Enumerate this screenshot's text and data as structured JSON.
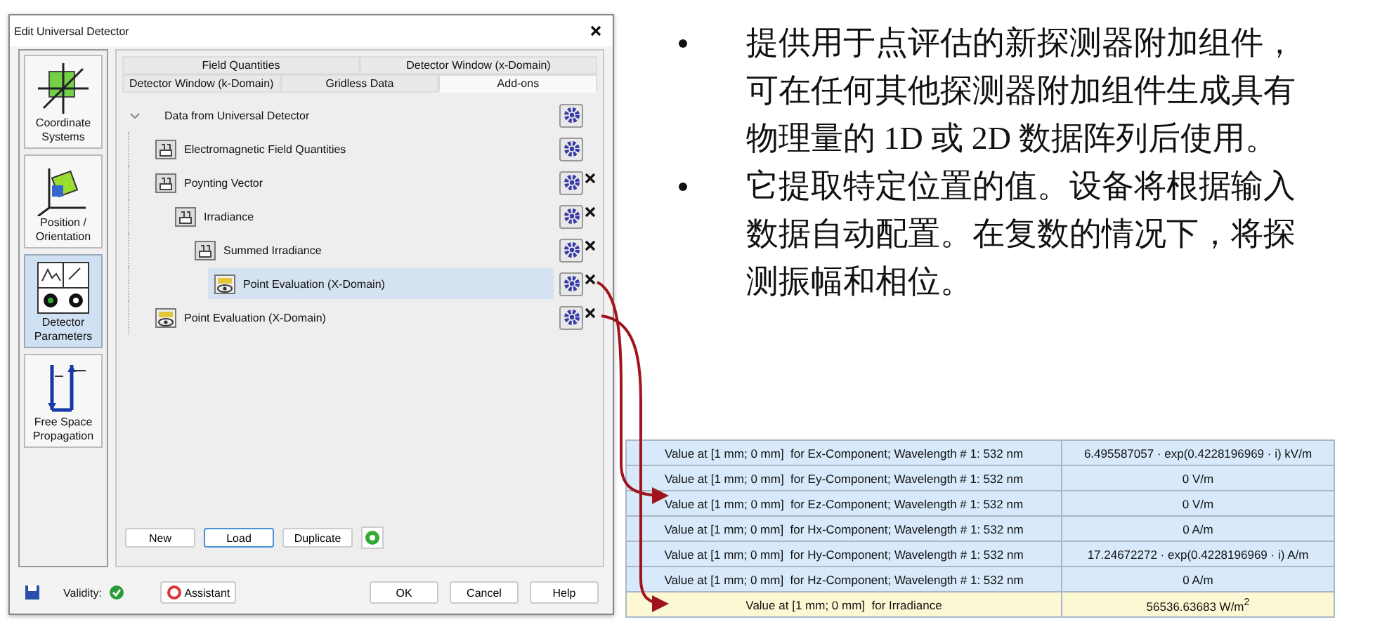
{
  "dialog": {
    "title": "Edit Universal Detector",
    "sidebar": [
      {
        "label": "Coordinate Systems",
        "selected": false
      },
      {
        "label": "Position / Orientation",
        "selected": false
      },
      {
        "label": "Detector Parameters",
        "selected": true
      },
      {
        "label": "Free Space Propagation",
        "selected": false
      }
    ],
    "tab_rows": [
      [
        {
          "label": "Field Quantities",
          "selected": false
        },
        {
          "label": "Detector Window (x-Domain)",
          "selected": false
        }
      ],
      [
        {
          "label": "Detector Window (k-Domain)",
          "selected": false
        },
        {
          "label": "Gridless Data",
          "selected": false
        },
        {
          "label": "Add-ons",
          "selected": true
        }
      ]
    ],
    "tree": {
      "label": "Data from Universal Detector",
      "expanded": true,
      "children": [
        {
          "label": "Electromagnetic Field Quantities",
          "kind": "module",
          "selected": false,
          "removable": false
        },
        {
          "label": "Poynting Vector",
          "kind": "module",
          "selected": false,
          "removable": true,
          "children": [
            {
              "label": "Irradiance",
              "kind": "module",
              "selected": false,
              "removable": true,
              "children": [
                {
                  "label": "Summed Irradiance",
                  "kind": "module",
                  "selected": false,
                  "removable": true,
                  "children": [
                    {
                      "label": "Point Evaluation (X-Domain)",
                      "kind": "evaluation",
                      "selected": true,
                      "removable": true
                    }
                  ]
                }
              ]
            }
          ]
        },
        {
          "label": "Point Evaluation (X-Domain)",
          "kind": "evaluation",
          "selected": false,
          "removable": true
        }
      ]
    },
    "actions": [
      "New",
      "Load",
      "Duplicate"
    ],
    "validity_label": "Validity:",
    "assistant": "Assistant",
    "buttons": [
      "OK",
      "Cancel",
      "Help"
    ]
  },
  "bullets": [
    "提供用于点评估的新探测器附加组件，可在任何其他探测器附加组件生成具有物理量的 1D 或 2D 数据阵列后使用。",
    "它提取特定位置的值。设备将根据输入数据自动配置。在复数的情况下，将探测振幅和相位。"
  ],
  "results": [
    {
      "label": "Value at [1 mm; 0 mm]  for Ex-Component; Wavelength # 1: 532 nm",
      "value": "6.495587057 · exp(0.4228196969 · i) kV/m",
      "highlighted": false
    },
    {
      "label": "Value at [1 mm; 0 mm]  for Ey-Component; Wavelength # 1: 532 nm",
      "value": "0 V/m",
      "highlighted": false
    },
    {
      "label": "Value at [1 mm; 0 mm]  for Ez-Component; Wavelength # 1: 532 nm",
      "value": "0 V/m",
      "highlighted": false
    },
    {
      "label": "Value at [1 mm; 0 mm]  for Hx-Component; Wavelength # 1: 532 nm",
      "value": "0 A/m",
      "highlighted": false
    },
    {
      "label": "Value at [1 mm; 0 mm]  for Hy-Component; Wavelength # 1: 532 nm",
      "value": "17.24672272 · exp(0.4228196969 · i) A/m",
      "highlighted": false
    },
    {
      "label": "Value at [1 mm; 0 mm]  for Hz-Component; Wavelength # 1: 532 nm",
      "value": "0 A/m",
      "highlighted": false
    },
    {
      "label": "Value at [1 mm; 0 mm]  for Irradiance",
      "value": "56536.63683 W/m$^{2}$",
      "highlighted": true
    }
  ]
}
